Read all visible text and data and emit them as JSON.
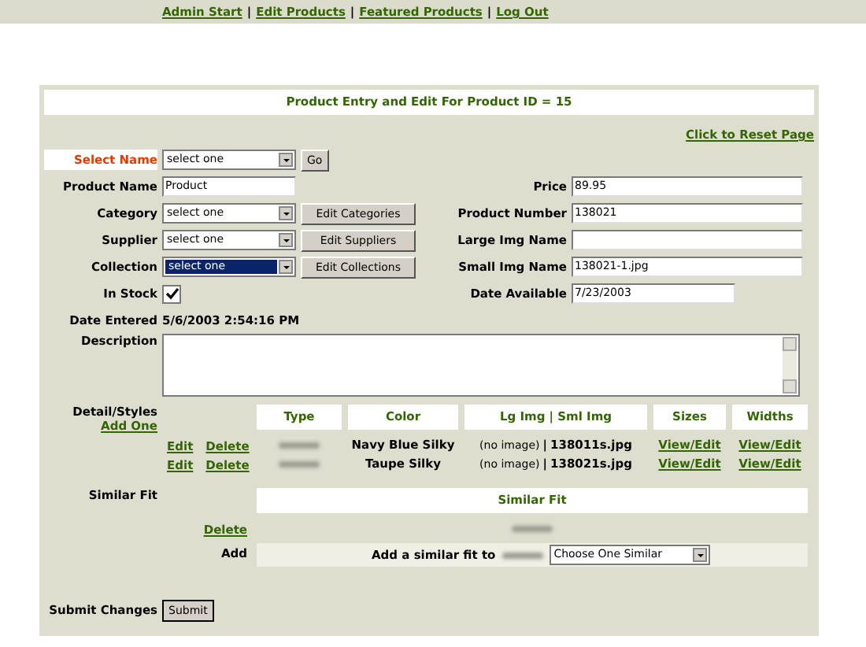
{
  "nav": {
    "links": [
      "Admin Start",
      "Edit Products",
      "Featured Products",
      "Log Out"
    ],
    "separator": "|"
  },
  "title": "Product Entry and Edit For Product ID = 15",
  "reset_link": "Click to Reset Page",
  "select_name": {
    "label": "Select Name",
    "value": "select one",
    "button": "Go"
  },
  "left_fields": [
    {
      "kind": "input",
      "label": "Product Name",
      "value": "Product"
    },
    {
      "kind": "select",
      "label": "Category",
      "value": "select one",
      "button": "Edit Categories",
      "focused": false
    },
    {
      "kind": "select",
      "label": "Supplier",
      "value": "select one",
      "button": "Edit Suppliers",
      "focused": false
    },
    {
      "kind": "select",
      "label": "Collection",
      "value": "select one",
      "button": "Edit Collections",
      "focused": true
    }
  ],
  "in_stock": {
    "label": "In Stock",
    "checked": true
  },
  "date_entered": {
    "label": "Date Entered",
    "value": "5/6/2003 2:54:16 PM"
  },
  "right_fields": [
    {
      "label": "Price",
      "value": "89.95",
      "wide": true
    },
    {
      "label": "Product Number",
      "value": "138021",
      "wide": true
    },
    {
      "label": "Large Img Name",
      "wide": true
    },
    {
      "label": "Small Img Name",
      "value": "138021-1.jpg",
      "wide": true
    },
    {
      "label": "Date Available",
      "value": "7/23/2003",
      "wide": false
    }
  ],
  "description": {
    "label": "Description"
  },
  "details": {
    "label": "Detail/Styles",
    "add_link": "Add One",
    "columns": [
      "Type",
      "Color",
      "Lg Img | Sml Img",
      "Sizes",
      "Widths"
    ],
    "rows": [
      {
        "edit": "Edit",
        "delete": "Delete",
        "color_name": "Navy Blue Silky",
        "lg_img": "(no image)",
        "sml_img": "138011s.jpg",
        "sizes": "View/Edit",
        "widths": "View/Edit"
      },
      {
        "edit": "Edit",
        "delete": "Delete",
        "color_name": "Taupe Silky",
        "lg_img": "(no image)",
        "sml_img": "138021s.jpg",
        "sizes": "View/Edit",
        "widths": "View/Edit"
      }
    ]
  },
  "similar_fit": {
    "label": "Similar Fit",
    "header": "Similar Fit",
    "delete": "Delete",
    "add_label": "Add",
    "add_text": "Add a similar fit to",
    "select_value": "Choose One Similar"
  },
  "submit": {
    "label": "Submit Changes",
    "button": "Submit"
  }
}
